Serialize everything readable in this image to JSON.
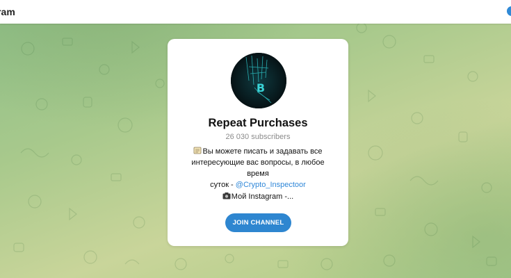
{
  "app": {
    "title": "ram"
  },
  "channel": {
    "name": "Repeat Purchases",
    "subscribers": "26 030 subscribers",
    "description_line1": "Вы можете писать и задавать все",
    "description_line2": "интересующие вас вопросы, в любое время",
    "description_line3_prefix": "суток - ",
    "description_link": "@Crypto_Inspectoor",
    "instagram_text": "Мой Instagram -...",
    "join_label": "JOIN CHANNEL"
  },
  "icons": {
    "description_emoji": "memo-icon",
    "instagram_emoji": "camera-icon",
    "avatar_symbol": "bitcoin-icon"
  },
  "colors": {
    "accent": "#2e86d0",
    "link": "#2f87d8",
    "background_green": "#a8c98c"
  }
}
